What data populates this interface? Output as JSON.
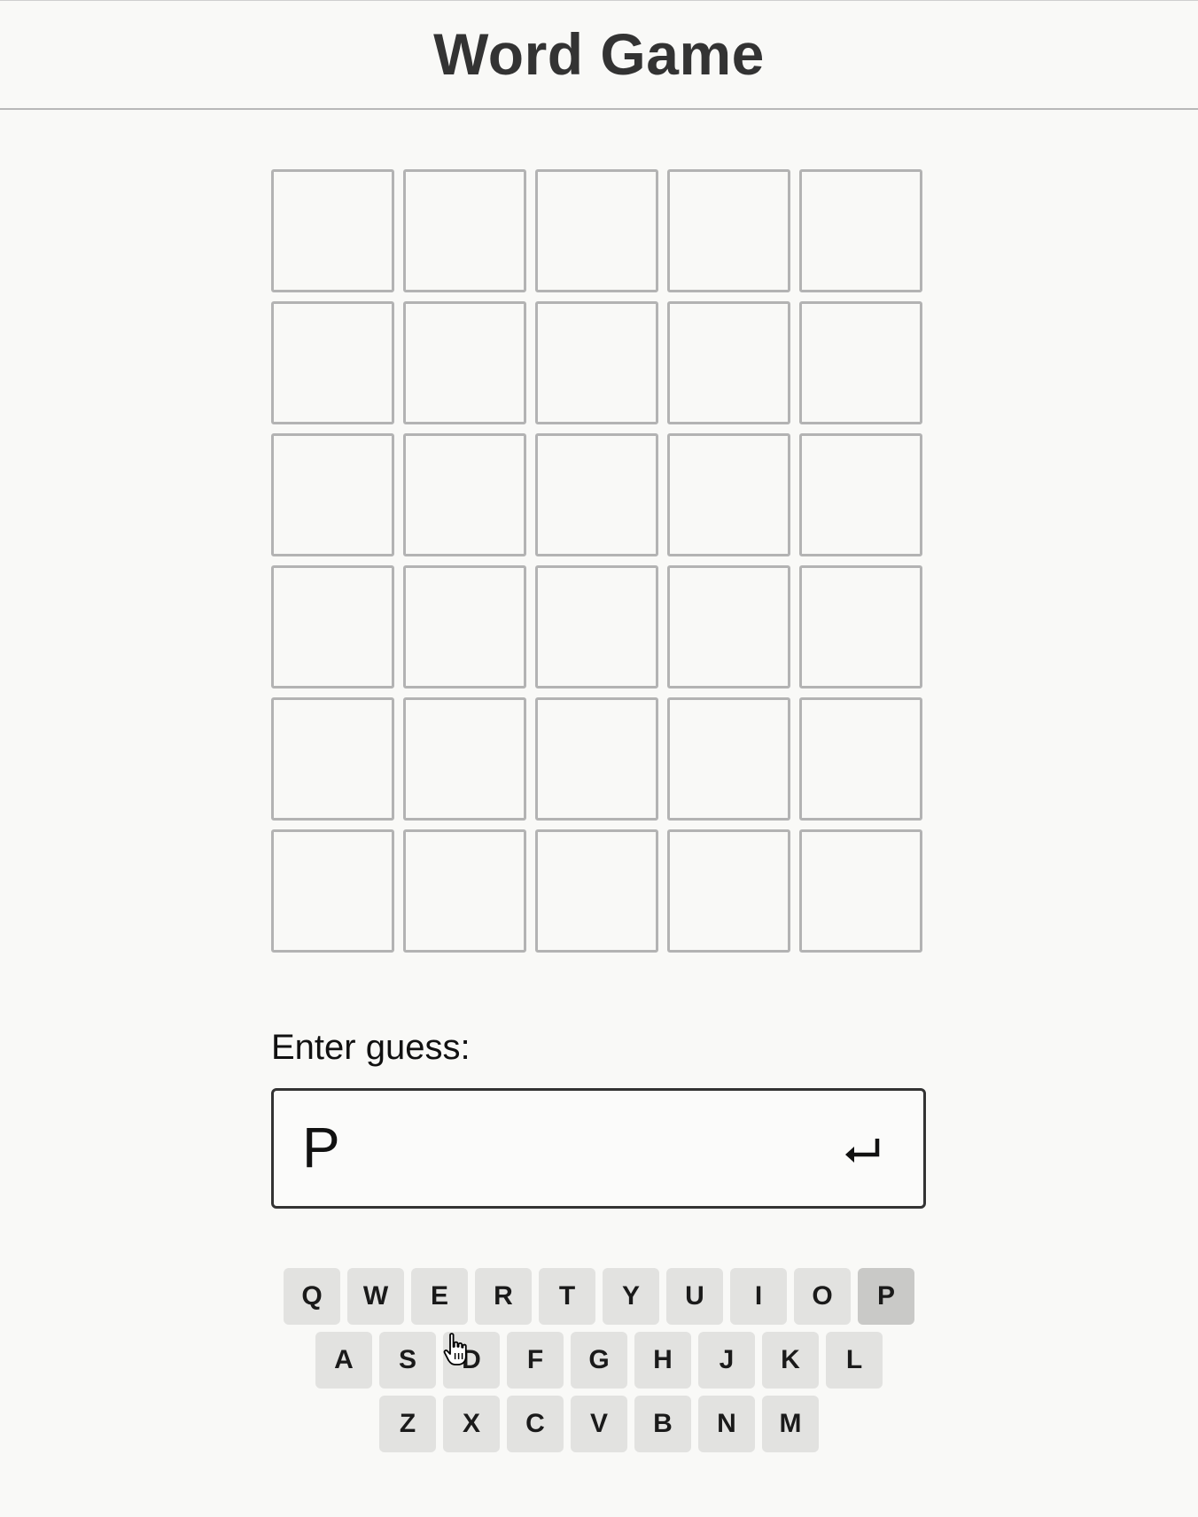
{
  "header": {
    "title": "Word Game"
  },
  "board": {
    "rows": 6,
    "columns": 5,
    "cells": [
      [
        "",
        "",
        "",
        "",
        ""
      ],
      [
        "",
        "",
        "",
        "",
        ""
      ],
      [
        "",
        "",
        "",
        "",
        ""
      ],
      [
        "",
        "",
        "",
        "",
        ""
      ],
      [
        "",
        "",
        "",
        "",
        ""
      ],
      [
        "",
        "",
        "",
        "",
        ""
      ]
    ]
  },
  "guess": {
    "label": "Enter guess:",
    "value": "P",
    "submit_icon": "return-arrow-icon"
  },
  "keyboard": {
    "rows": [
      [
        "Q",
        "W",
        "E",
        "R",
        "T",
        "Y",
        "U",
        "I",
        "O",
        "P"
      ],
      [
        "A",
        "S",
        "D",
        "F",
        "G",
        "H",
        "J",
        "K",
        "L"
      ],
      [
        "Z",
        "X",
        "C",
        "V",
        "B",
        "N",
        "M"
      ]
    ],
    "pressed_key": "P",
    "hovered_key": "D"
  },
  "colors": {
    "background": "#f9f9f7",
    "cell_border": "#b3b3b3",
    "key_bg": "#e2e2e0",
    "key_pressed_bg": "#c9c9c7",
    "input_border": "#333333"
  },
  "cursor_icon": "hand-pointer-icon"
}
